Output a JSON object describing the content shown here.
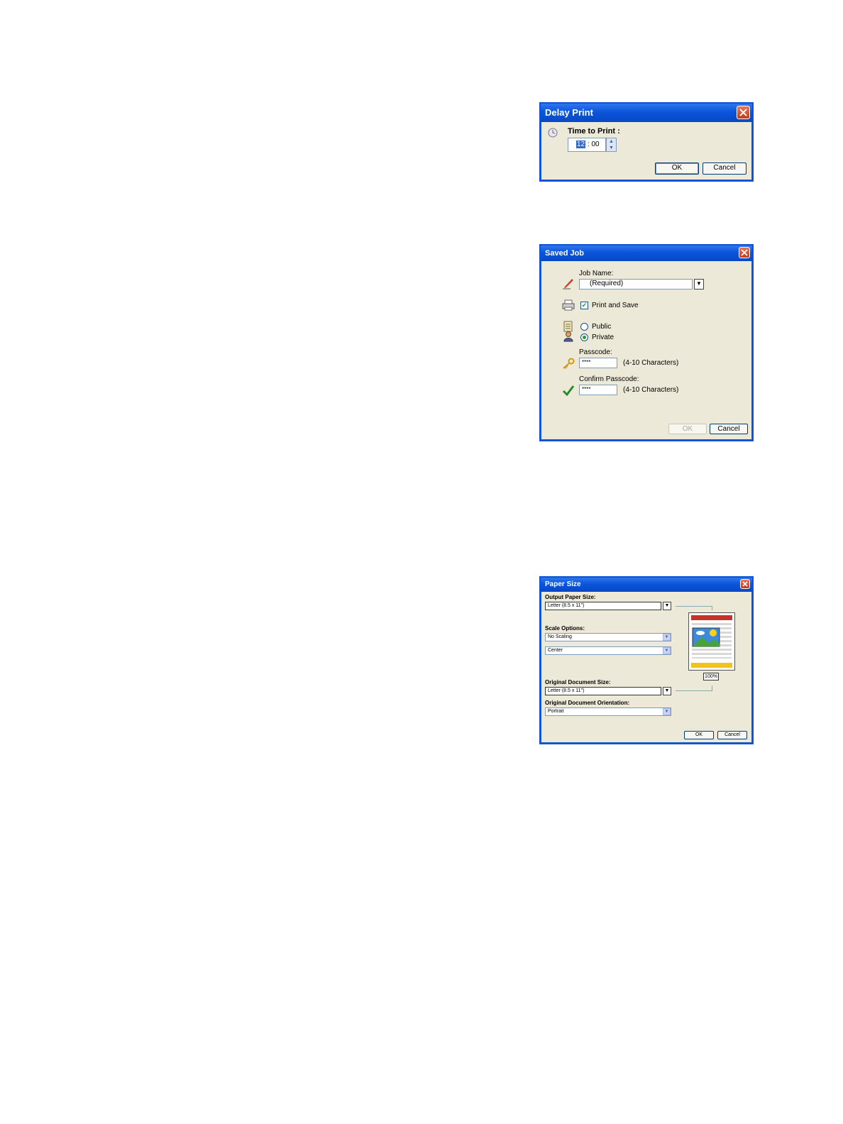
{
  "delay_print": {
    "title": "Delay Print",
    "time_label": "Time to Print :",
    "hour": "12",
    "separator": ":",
    "minute": "00",
    "ok_label": "OK",
    "cancel_label": "Cancel"
  },
  "saved_job": {
    "title": "Saved Job",
    "job_name_label": "Job Name:",
    "job_name_value": "(Required)",
    "print_and_save_label": "Print and Save",
    "print_and_save_checked": true,
    "public_label": "Public",
    "private_label": "Private",
    "selected": "Private",
    "passcode_label": "Passcode:",
    "passcode_value": "****",
    "passcode_hint": "(4-10 Characters)",
    "confirm_label": "Confirm Passcode:",
    "confirm_value": "****",
    "confirm_hint": "(4-10 Characters)",
    "ok_label": "OK",
    "cancel_label": "Cancel"
  },
  "paper_size": {
    "title": "Paper Size",
    "output_label": "Output Paper Size:",
    "output_value": "Letter (8.5 x 11\")",
    "scale_label": "Scale Options:",
    "scale_value": "No Scaling",
    "position_value": "Center",
    "original_label": "Original Document Size:",
    "original_value": "Letter (8.5 x 11\")",
    "orientation_label": "Original Document Orientation:",
    "orientation_value": "Portrait",
    "zoom": "100%",
    "ok_label": "OK",
    "cancel_label": "Cancel"
  },
  "colors": {
    "titlebar": "#0a55dc",
    "dialog_bg": "#ece9d8",
    "close": "#c63a1c"
  }
}
